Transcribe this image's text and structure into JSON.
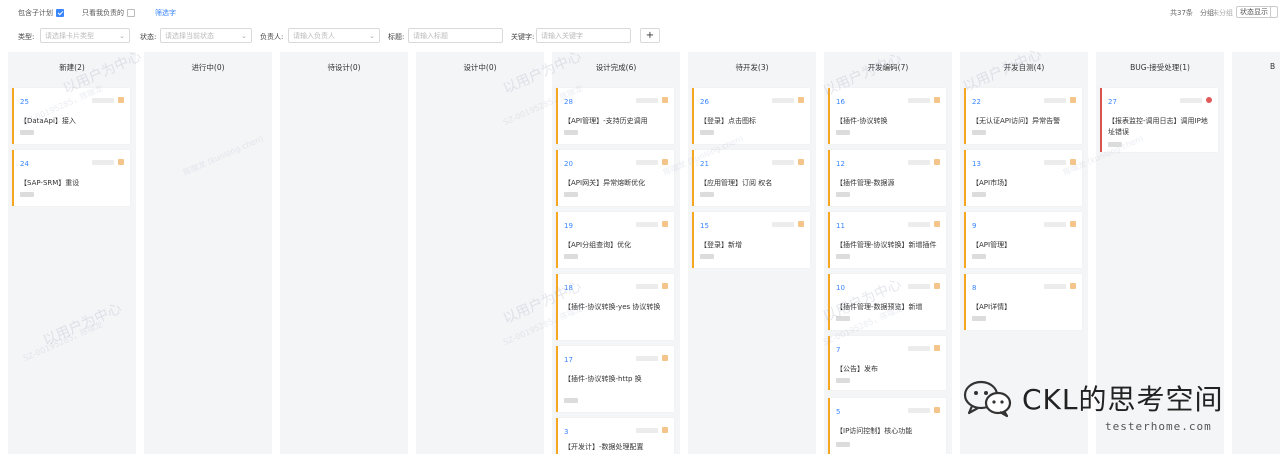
{
  "topbar": {
    "include_subplan_label": "包含子计划",
    "only_mine_label": "只看我负责的",
    "filter_link": "筛选字",
    "total": "共37条",
    "group_label": "分组",
    "group_value": "未分组",
    "status_display_btn": "状态显示",
    "settings_btn": ""
  },
  "filters": {
    "type_label": "类型:",
    "type_placeholder": "请选择卡片类型",
    "status_label": "状态:",
    "status_placeholder": "请选择当前状态",
    "owner_label": "负责人:",
    "owner_placeholder": "请输入负责人",
    "title_label": "标题:",
    "title_placeholder": "请输入标题",
    "keyword_label": "关键字:",
    "keyword_placeholder": "请输入关键字",
    "add_label": "+"
  },
  "columns": [
    {
      "title": "新建(2)",
      "cards": [
        {
          "num": "25",
          "title": "【DataApi】接入"
        },
        {
          "num": "24",
          "title": "【SAP-SRM】重设"
        }
      ]
    },
    {
      "title": "进行中(0)",
      "cards": []
    },
    {
      "title": "待设计(0)",
      "cards": []
    },
    {
      "title": "设计中(0)",
      "cards": []
    },
    {
      "title": "设计完成(6)",
      "cards": [
        {
          "num": "28",
          "title": "【API管理】-支持历史调用"
        },
        {
          "num": "20",
          "title": "【API网关】异常熔断优化"
        },
        {
          "num": "19",
          "title": "【API分组查询】优化"
        },
        {
          "num": "18",
          "title": "【插件-协议转换-yes        协议转换"
        },
        {
          "num": "17",
          "title": "【插件-协议转换-http       换"
        },
        {
          "num": "3",
          "title": "【开发计】-数据处理配置"
        }
      ]
    },
    {
      "title": "待开发(3)",
      "cards": [
        {
          "num": "26",
          "title": "【登录】点击图标"
        },
        {
          "num": "21",
          "title": "【应用管理】订阅      权名"
        },
        {
          "num": "15",
          "title": "【登录】新增"
        }
      ]
    },
    {
      "title": "开发编码(7)",
      "cards": [
        {
          "num": "16",
          "title": "【插件-协议转换"
        },
        {
          "num": "12",
          "title": "【插件管理-数据源"
        },
        {
          "num": "11",
          "title": "【插件管理-协议转换】新增插件"
        },
        {
          "num": "10",
          "title": "【插件管理-数据预览】新增"
        },
        {
          "num": "7",
          "title": "【公告】发布"
        },
        {
          "num": "5",
          "title": "【IP访问控制】核心功能"
        }
      ]
    },
    {
      "title": "开发自测(4)",
      "cards": [
        {
          "num": "22",
          "title": "【无认证API访问】异常告警"
        },
        {
          "num": "13",
          "title": "【API市场】"
        },
        {
          "num": "9",
          "title": "【API管理】"
        },
        {
          "num": "8",
          "title": "【API详情】"
        }
      ]
    },
    {
      "title": "BUG-接受处理(1)",
      "cards": [
        {
          "num": "27",
          "title": "【报表监控-调用日志】调用IP地址错误"
        }
      ]
    },
    {
      "title": "B",
      "cards": []
    }
  ],
  "watermark": {
    "main": "以用户为中心",
    "id": "SZ-00195285，陈咖龙",
    "name": "陈咖龙 (kunlong.chen)"
  },
  "logo": {
    "text": "CKL的思考空间",
    "sub": "testerhome.com"
  },
  "colors": {
    "accent": "#3a86ff",
    "card_border": "#f5a623",
    "bug_border": "#d9534f",
    "column_bg": "#f4f5f7"
  }
}
